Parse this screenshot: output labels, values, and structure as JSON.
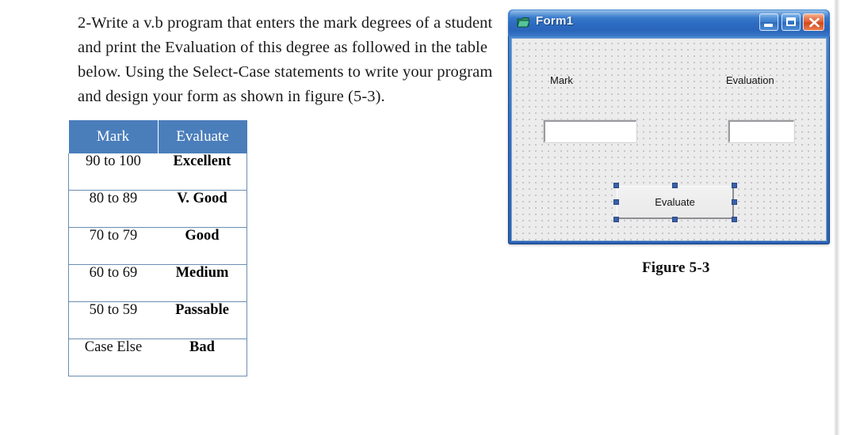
{
  "question": {
    "text": "2-Write a v.b program that enters the mark degrees of a student and print the Evaluation of this degree as followed in the table below. Using the Select-Case statements to write your program and design your form as shown in figure (5-3)."
  },
  "grade_table": {
    "headers": [
      "Mark",
      "Evaluate"
    ],
    "rows": [
      {
        "mark": "90 to 100",
        "evaluate": "Excellent"
      },
      {
        "mark": "80 to 89",
        "evaluate": "V. Good"
      },
      {
        "mark": "70 to 79",
        "evaluate": "Good"
      },
      {
        "mark": "60 to 69",
        "evaluate": "Medium"
      },
      {
        "mark": "50 to 59",
        "evaluate": "Passable"
      },
      {
        "mark": "Case Else",
        "evaluate": "Bad"
      }
    ],
    "header_bg": "#4a7ebb",
    "header_fg": "#ffffff",
    "border_color": "#6b8db3"
  },
  "vb_form": {
    "title": "Form1",
    "icon": "form-window-icon",
    "titlebar_color_top": "#4f93d9",
    "titlebar_color_bottom": "#2a63b8",
    "window_buttons": [
      {
        "name": "minimize",
        "glyph": "minimize-icon"
      },
      {
        "name": "maximize",
        "glyph": "maximize-icon"
      },
      {
        "name": "close",
        "glyph": "close-icon",
        "color": "#d1481d"
      }
    ],
    "labels": [
      {
        "name": "mark",
        "text": "Mark"
      },
      {
        "name": "evaluation",
        "text": "Evaluation"
      }
    ],
    "textboxes": [
      {
        "name": "mark",
        "value": "",
        "placeholder": ""
      },
      {
        "name": "evaluation",
        "value": "",
        "placeholder": ""
      }
    ],
    "button": {
      "label": "Evaluate",
      "selected": true,
      "handle_color": "#3a5fa8"
    }
  },
  "figure": {
    "caption": "Figure 5-3"
  }
}
